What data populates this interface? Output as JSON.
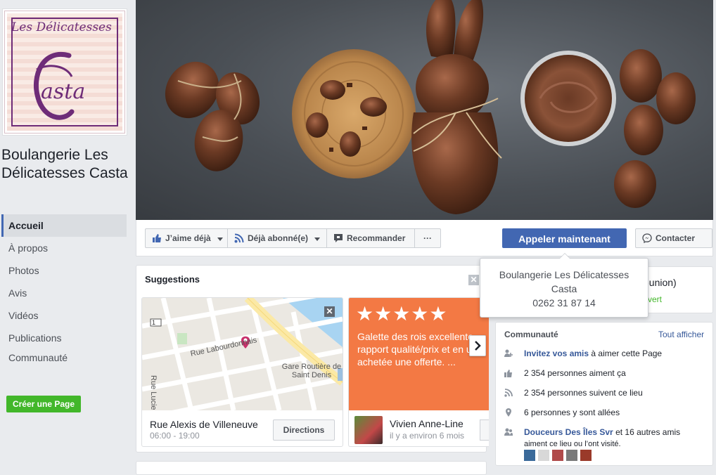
{
  "logo": {
    "line1": "Les Délicatesses",
    "line2": "asta"
  },
  "page_name": "Boulangerie Les Délicatesses Casta",
  "nav": [
    {
      "label": "Accueil",
      "active": true
    },
    {
      "label": "À propos"
    },
    {
      "label": "Photos"
    },
    {
      "label": "Avis"
    },
    {
      "label": "Vidéos"
    },
    {
      "label": "Publications"
    },
    {
      "label": "Communauté"
    }
  ],
  "create_page": "Créer une Page",
  "actions": {
    "like": "J’aime déjà",
    "follow": "Déjà abonné(e)",
    "recommend": "Recommander",
    "more": "···",
    "call": "Appeler maintenant",
    "contact": "Contacter"
  },
  "popover": {
    "name": "Boulangerie Les Délicatesses Casta",
    "phone": "0262 31 87 14"
  },
  "suggestions": {
    "title": "Suggestions",
    "map_card": {
      "street1": "Rue Labourdonnais",
      "street2": "Rue Lucie",
      "station": "Gare Routière de Saint Denis",
      "road_num": "1",
      "address": "Rue Alexis de Villeneuve",
      "hours": "06:00 - 19:00",
      "directions": "Directions"
    },
    "review_card": {
      "stars": "★★★★★",
      "text": "Galette des rois excellente rapport qualité/prix et en une achetée une offerte. ...",
      "author": "Vivien Anne-Line",
      "time": "il y a environ 6 mois"
    }
  },
  "info": {
    "line1": "éunion)",
    "line2": "vert"
  },
  "community": {
    "title": "Communauté",
    "see_all": "Tout afficher",
    "invite_link": "Invitez vos amis",
    "invite_rest": " à aimer cette Page",
    "likes": "2 354 personnes aiment ça",
    "follows": "2 354 personnes suivent ce lieu",
    "visits": "6 personnes y sont allées",
    "friends_link": "Douceurs Des Îles Svr",
    "friends_rest": " et 16 autres amis",
    "friends_line2": "aiment ce lieu ou l’ont visité."
  },
  "colors": {
    "brand": "#4267b2",
    "green": "#42b72a",
    "review_orange": "#f37944",
    "logo_purple": "#6e2c78"
  }
}
